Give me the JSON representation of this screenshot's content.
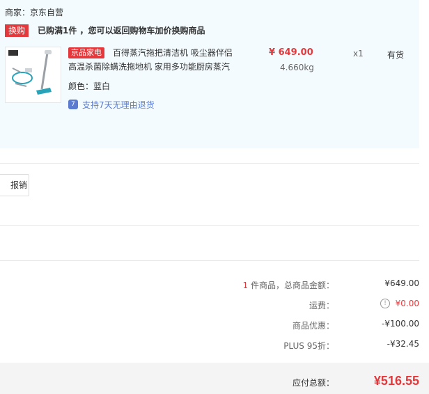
{
  "seller": {
    "text": "商家：京东自营"
  },
  "promo": {
    "tag": "换购",
    "text": "已购满1件 ，您可以返回购物车加价换购商品"
  },
  "item": {
    "thumb_icon": "steam-mop-product-image",
    "badge": "京品家电",
    "title_line1": "百得蒸汽拖把清洁机 吸尘器伴侣",
    "title_line2": "高温杀菌除螨洗拖地机 家用多功能厨房蒸汽",
    "price": "¥ 649.00",
    "weight": "4.660kg",
    "qty": "x1",
    "stock": "有货",
    "color": "颜色：蓝白",
    "return_icon": "7",
    "return_text": "支持7天无理由退货"
  },
  "expense": {
    "button_label": "报销"
  },
  "summary": {
    "count_num": "1",
    "count_label": " 件商品，总商品金额：",
    "goods_total": "¥649.00",
    "fee_label": "运费：",
    "fee_icon": "!",
    "fee_val": "¥0.00",
    "discount_label": "商品优惠：",
    "discount_val": "-¥100.00",
    "plus_label": "PLUS 95折：",
    "plus_val": "-¥32.45",
    "total_label": "应付总额：",
    "total_val": "¥516.55"
  },
  "colors": {
    "accent": "#e4393c",
    "link": "#5a7bd0",
    "panel": "#f3fbfe"
  }
}
